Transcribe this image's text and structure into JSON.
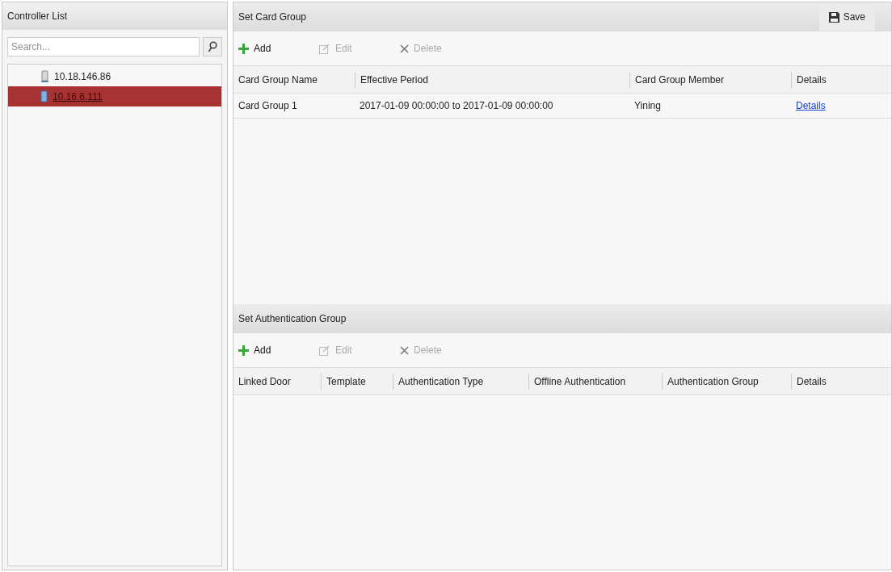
{
  "controller_list": {
    "title": "Controller List",
    "search": {
      "placeholder": "Search..."
    },
    "items": [
      {
        "label": "10.18.146.86",
        "selected": false
      },
      {
        "label": "10.16.6.111",
        "selected": true
      }
    ]
  },
  "card_group": {
    "title": "Set Card Group",
    "save_button": "Save",
    "toolbar": [
      {
        "kind": "add",
        "label": "Add",
        "disabled": false
      },
      {
        "kind": "edit",
        "label": "Edit",
        "disabled": true
      },
      {
        "kind": "delete",
        "label": "Delete",
        "disabled": true
      }
    ],
    "table": {
      "columns": [
        "Card Group Name",
        "Effective Period",
        "Card Group Member",
        "Details"
      ],
      "rows": [
        [
          "Card Group 1",
          "2017-01-09 00:00:00 to 2017-01-09 00:00:00",
          "Yining",
          "Details"
        ]
      ]
    }
  },
  "authentication_group": {
    "title": "Set Authentication Group",
    "toolbar": [
      {
        "kind": "add",
        "label": "Add",
        "disabled": false
      },
      {
        "kind": "edit",
        "label": "Edit",
        "disabled": true
      },
      {
        "kind": "delete",
        "label": "Delete",
        "disabled": true
      }
    ],
    "table": {
      "columns": [
        "Linked Door",
        "Template",
        "Authentication Type",
        "Offline Authentication",
        "Authentication Group",
        "Details"
      ]
    }
  }
}
